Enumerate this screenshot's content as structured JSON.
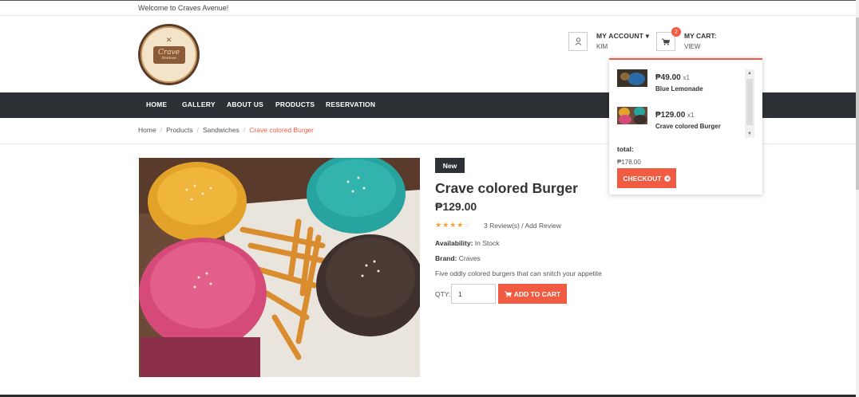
{
  "topbar": {
    "welcome": "Welcome to Craves Avenue!"
  },
  "logo": {
    "text": "Crave",
    "subtext": "Avenue"
  },
  "account": {
    "label": "MY ACCOUNT",
    "caret": "▾",
    "user": "KIM",
    "icon": "user-icon"
  },
  "cart": {
    "label": "MY CART:",
    "view": "VIEW",
    "count": "2",
    "icon": "cart-icon"
  },
  "nav": {
    "items": [
      "HOME",
      "GALLERY",
      "ABOUT US",
      "PRODUCTS",
      "RESERVATION"
    ]
  },
  "breadcrumb": {
    "items": [
      "Home",
      "Products",
      "Sandwiches"
    ],
    "current": "Crave colored Burger"
  },
  "product": {
    "tag": "New",
    "title": "Crave colored Burger",
    "price": "₱129.00",
    "rating": 4,
    "rating_max": 5,
    "reviews": "3 Review(s) / Add Review",
    "availability_label": "Availability:",
    "availability": "In Stock",
    "brand_label": "Brand:",
    "brand": "Craves",
    "description": "Five oddly colored burgers that can snitch your appetite",
    "qty_label": "QTY:",
    "qty": "1",
    "add_to_cart": "ADD TO CART"
  },
  "cart_dropdown": {
    "items": [
      {
        "price": "₱49.00",
        "qty": "x1",
        "name": "Blue Lemonade"
      },
      {
        "price": "₱129.00",
        "qty": "x1",
        "name": "Crave colored Burger"
      }
    ],
    "total_label": "total:",
    "total": "₱178.00",
    "checkout": "CHECKOUT"
  },
  "colors": {
    "accent": "#f05b41",
    "nav_bg": "#2d3035",
    "star": "#f7a12b"
  }
}
